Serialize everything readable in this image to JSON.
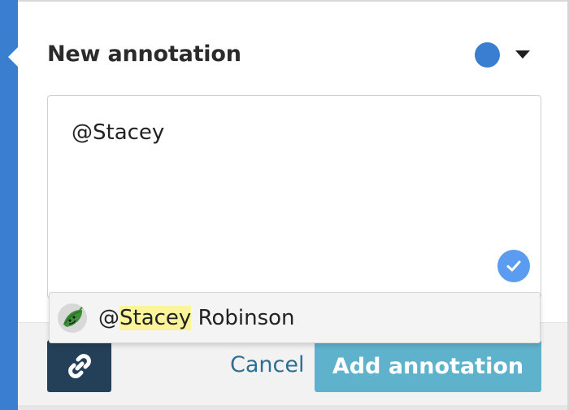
{
  "panel": {
    "title": "New annotation",
    "accent_color": "#3a7ed0",
    "color_picker": {
      "selected_color": "#3a7ed0",
      "icon": "chevron-down-icon"
    }
  },
  "editor": {
    "value": "@Stacey",
    "status_icon": "check-icon",
    "status_color": "#5b9cf0"
  },
  "mention_suggestion": {
    "prefix": "@",
    "match": "Stacey",
    "rest": " Robinson",
    "avatar_icon": "pea-pod-avatar",
    "highlight_color": "#fbf49a"
  },
  "footer": {
    "link_icon": "link-icon",
    "cancel_label": "Cancel",
    "add_label": "Add annotation",
    "add_button_color": "#5fb2cb",
    "link_button_color": "#243f58"
  }
}
